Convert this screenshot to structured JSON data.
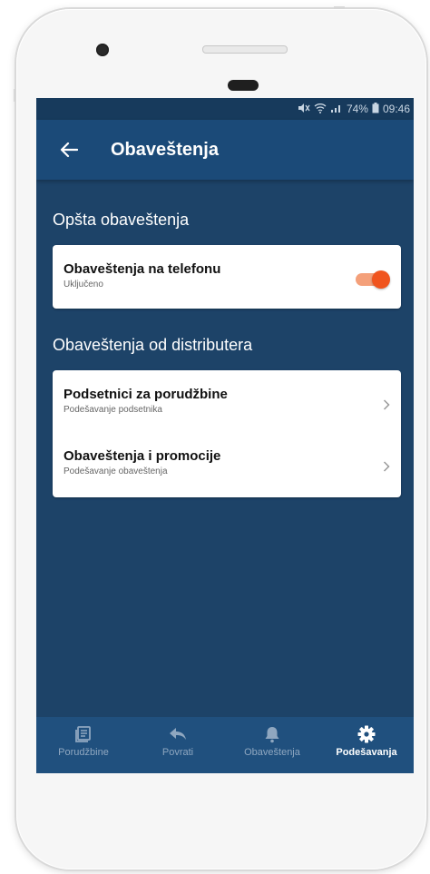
{
  "status_bar": {
    "icons": [
      "mute-icon",
      "wifi-icon",
      "signal-icon"
    ],
    "battery": "74%",
    "time": "09:46"
  },
  "app_bar": {
    "back_icon": "arrow-left-icon",
    "title": "Obaveštenja"
  },
  "sections": {
    "general": {
      "title": "Opšta obaveštenja",
      "items": [
        {
          "title": "Obaveštenja na telefonu",
          "subtitle": "Uključeno",
          "toggle_on": true
        }
      ]
    },
    "distributor": {
      "title": "Obaveštenja od distributera",
      "items": [
        {
          "title": "Podsetnici za porudžbine",
          "subtitle": "Podešavanje podsetnika"
        },
        {
          "title": "Obaveštenja i promocije",
          "subtitle": "Podešavanje obaveštenja"
        }
      ]
    }
  },
  "bottom_nav": {
    "items": [
      {
        "label": "Porudžbine",
        "icon": "orders-icon",
        "active": false
      },
      {
        "label": "Povrati",
        "icon": "reply-icon",
        "active": false
      },
      {
        "label": "Obaveštenja",
        "icon": "bell-icon",
        "active": false
      },
      {
        "label": "Podešavanja",
        "icon": "gear-icon",
        "active": true
      }
    ]
  },
  "colors": {
    "background": "#1d4368",
    "app_bar": "#1b4a78",
    "accent": "#f0541e",
    "nav_active": "#ffffff",
    "nav_inactive": "#8fa7c0"
  }
}
